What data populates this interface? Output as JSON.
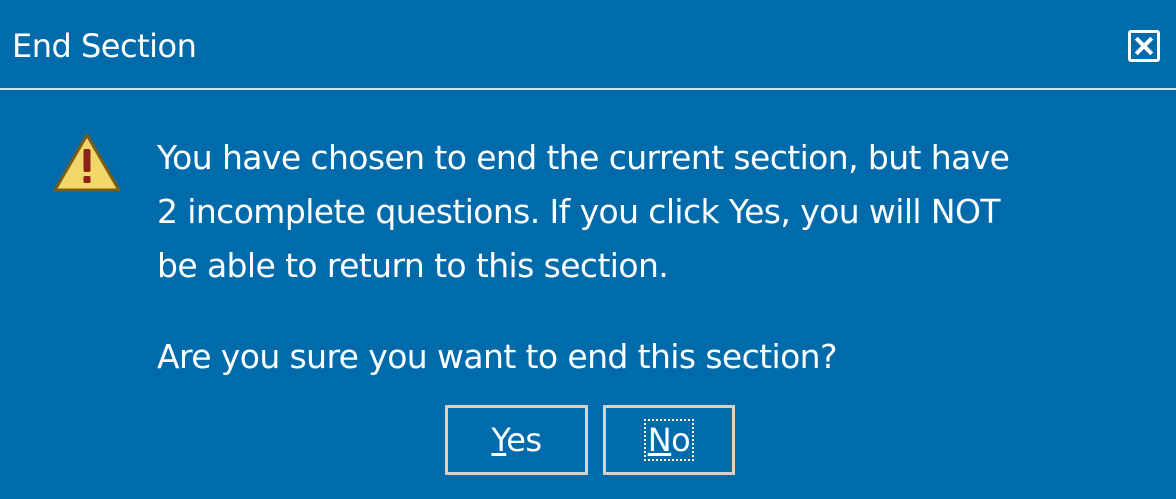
{
  "dialog": {
    "title": "End Section",
    "close_icon": "close-icon",
    "warning_icon": "warning-icon",
    "message": "You have chosen to end the current section, but have 2 incomplete questions.  If you click Yes, you will NOT be able to return to this section.",
    "message_lines": [
      "You have chosen to end the current section, but have",
      "2 incomplete questions.  If you click Yes, you will NOT",
      "be able to return to this section."
    ],
    "question": "Are you sure you want to end this section?",
    "buttons": {
      "yes": {
        "mnemonic": "Y",
        "rest": "es"
      },
      "no": {
        "mnemonic": "N",
        "rest": "o"
      }
    },
    "colors": {
      "background": "#006bab",
      "text": "#ffffff",
      "warning_fill": "#f1d66a",
      "warning_stroke": "#7a5d14"
    }
  }
}
